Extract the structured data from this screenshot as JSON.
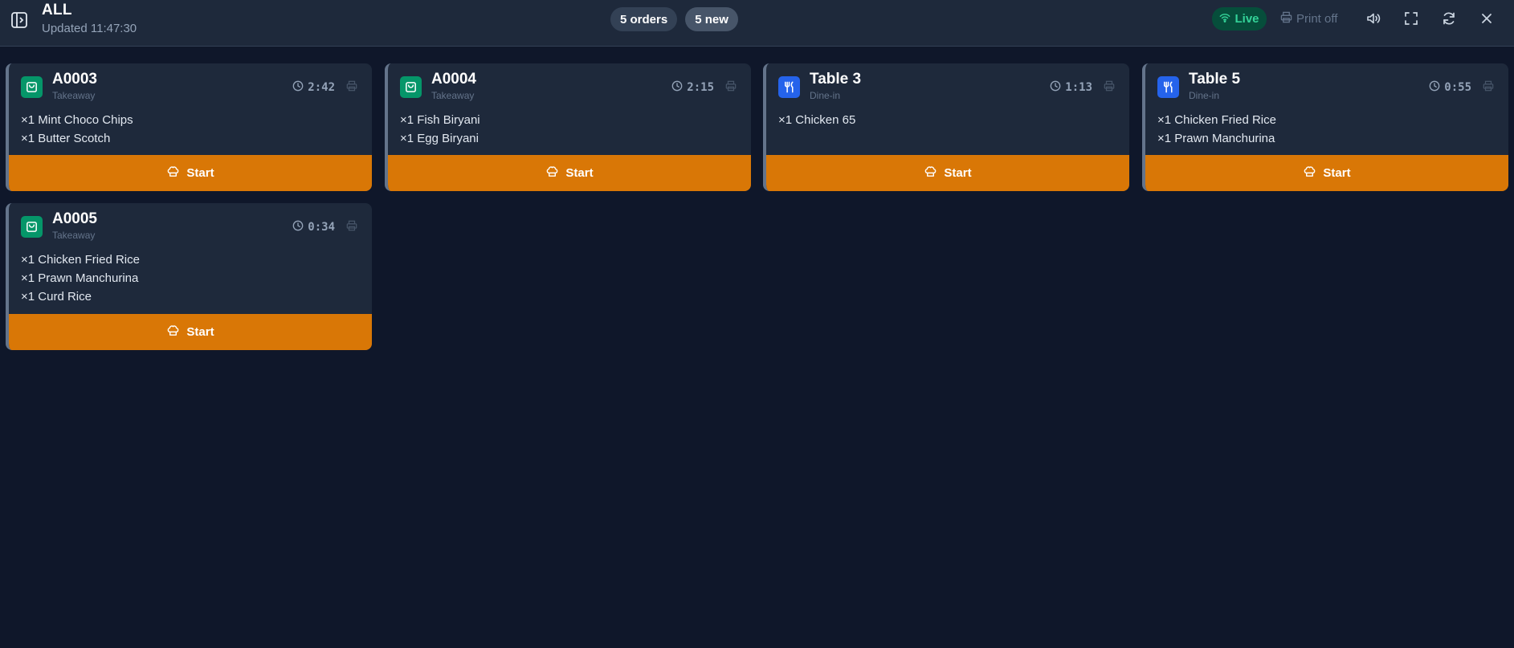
{
  "header": {
    "title": "ALL",
    "updated": "Updated 11:47:30",
    "orders_count": "5 orders",
    "new_count": "5 new",
    "live_label": "Live",
    "print_label": "Print off",
    "icons": [
      "sidebar-toggle-icon",
      "wifi-icon",
      "printer-icon",
      "volume-icon",
      "fullscreen-icon",
      "refresh-icon",
      "close-icon"
    ]
  },
  "orders": [
    {
      "name": "A0003",
      "type": "Takeaway",
      "timer": "2:42",
      "items": [
        "×1 Mint Choco Chips",
        "×1 Butter Scotch"
      ],
      "action": "Start"
    },
    {
      "name": "A0004",
      "type": "Takeaway",
      "timer": "2:15",
      "items": [
        "×1 Fish Biryani",
        "×1 Egg Biryani"
      ],
      "action": "Start"
    },
    {
      "name": "Table 3",
      "type": "Dine-in",
      "timer": "1:13",
      "items": [
        "×1 Chicken 65"
      ],
      "action": "Start"
    },
    {
      "name": "Table 5",
      "type": "Dine-in",
      "timer": "0:55",
      "items": [
        "×1 Chicken Fried Rice",
        "×1 Prawn Manchurina"
      ],
      "action": "Start"
    },
    {
      "name": "A0005",
      "type": "Takeaway",
      "timer": "0:34",
      "items": [
        "×1 Chicken Fried Rice",
        "×1 Prawn Manchurina",
        "×1 Curd Rice"
      ],
      "action": "Start"
    }
  ],
  "colors": {
    "background": "#0f172a",
    "card": "#1e293b",
    "accent_orange": "#d97706",
    "takeaway_green": "#059669",
    "dinein_blue": "#2563eb",
    "live_green": "#34d399"
  }
}
